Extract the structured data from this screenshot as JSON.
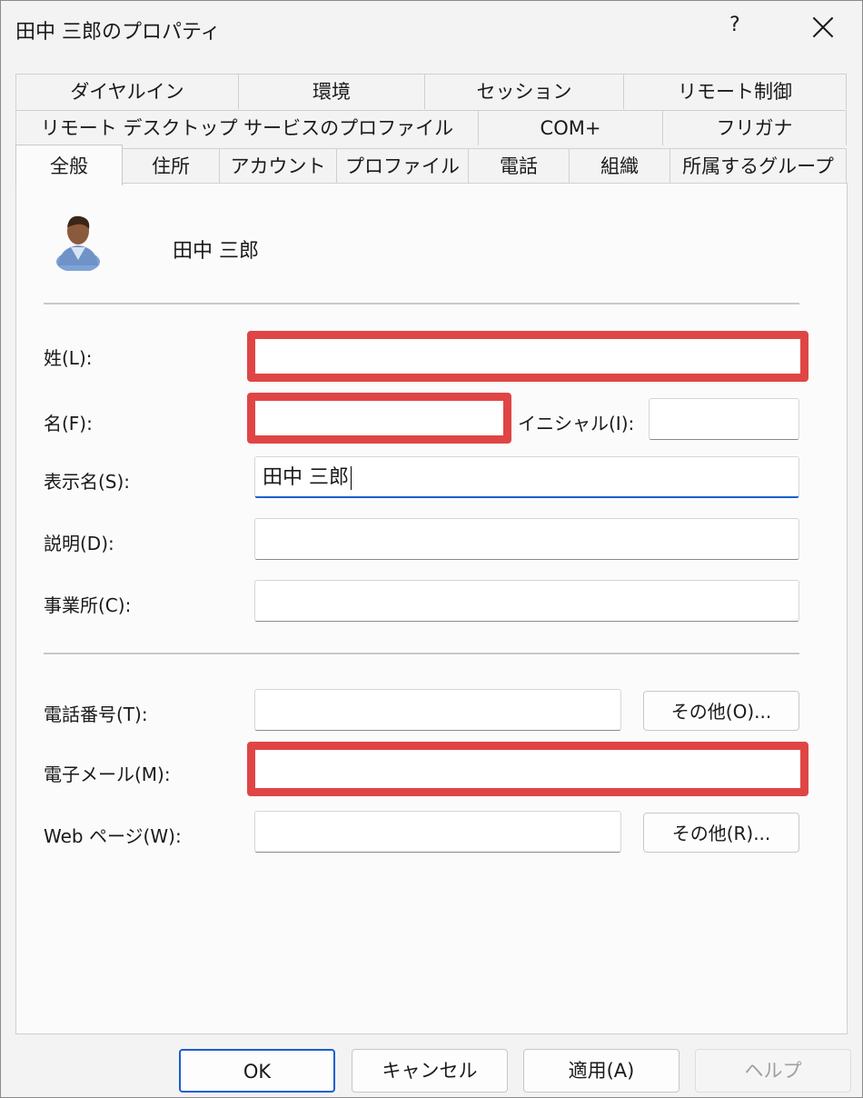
{
  "window": {
    "title": "田中 三郎のプロパティ",
    "help_label": "?",
    "close_label": ""
  },
  "tabs": {
    "row1": [
      "ダイヤルイン",
      "環境",
      "セッション",
      "リモート制御"
    ],
    "row2": [
      "リモート デスクトップ サービスのプロファイル",
      "COM+",
      "フリガナ"
    ],
    "row3": [
      "全般",
      "住所",
      "アカウント",
      "プロファイル",
      "電話",
      "組織",
      "所属するグループ"
    ],
    "active": "全般"
  },
  "user": {
    "display": "田中 三郎",
    "icon": "user-avatar-icon"
  },
  "form": {
    "last_name_label": "姓(L):",
    "first_name_label": "名(F):",
    "initials_label": "イニシャル(I):",
    "display_name_label": "表示名(S):",
    "display_name_value": "田中 三郎",
    "description_label": "説明(D):",
    "office_label": "事業所(C):",
    "phone_label": "電話番号(T):",
    "phone_other": "その他(O)...",
    "email_label": "電子メール(M):",
    "web_label": "Web ページ(W):",
    "web_other": "その他(R)..."
  },
  "footer": {
    "ok": "OK",
    "cancel": "キャンセル",
    "apply": "適用(A)",
    "help": "ヘルプ"
  },
  "colors": {
    "redaction": "#e04545",
    "focus": "#1b5fcf"
  }
}
